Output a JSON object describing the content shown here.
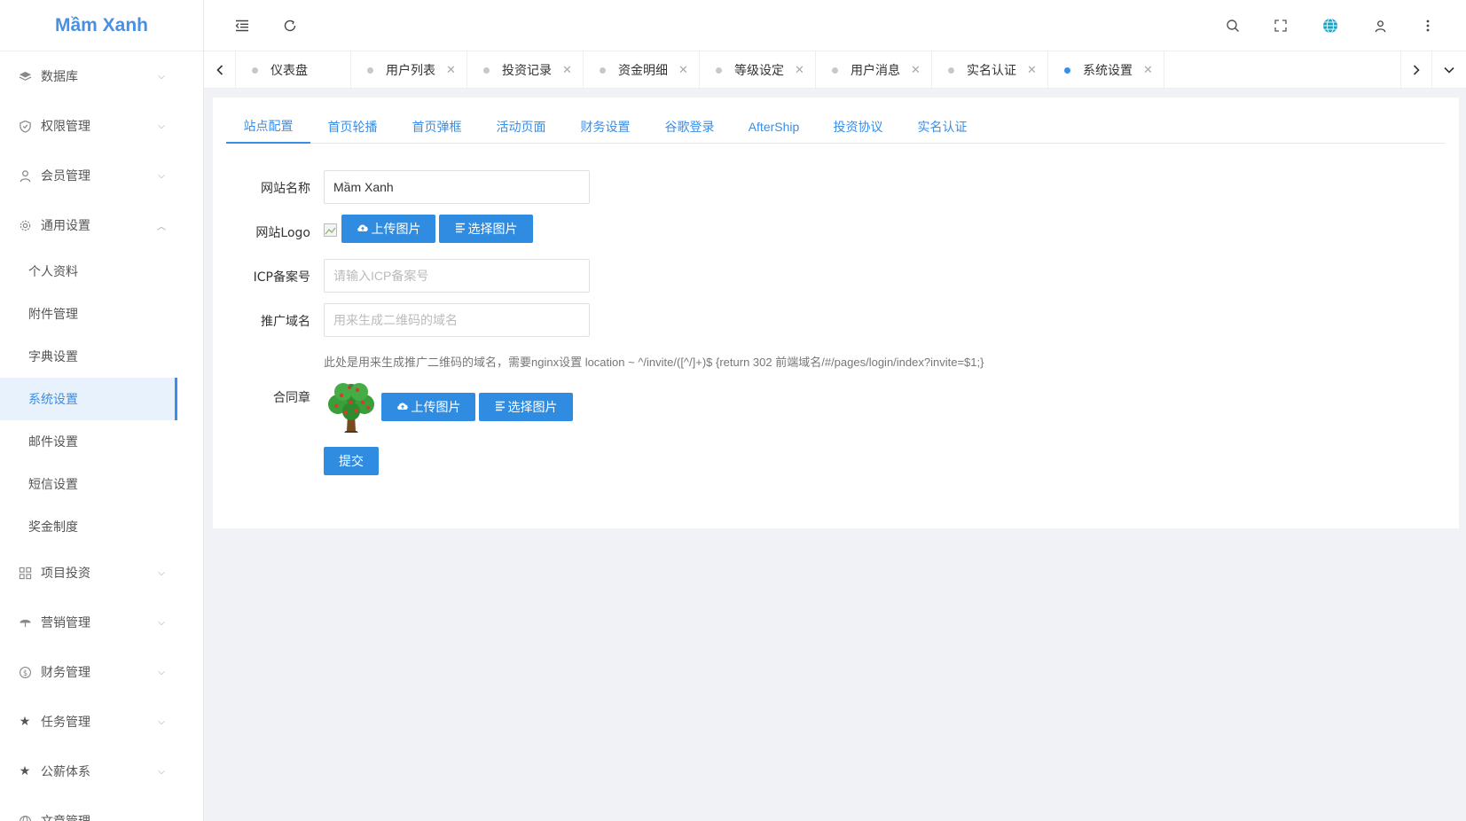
{
  "app": {
    "logo": "Mầm Xanh"
  },
  "sidebar": {
    "items": [
      {
        "label": "数据库",
        "icon": "layers-icon"
      },
      {
        "label": "权限管理",
        "icon": "shield-check-icon"
      },
      {
        "label": "会员管理",
        "icon": "user-icon"
      },
      {
        "label": "通用设置",
        "icon": "gear-icon",
        "expanded": true
      }
    ],
    "sub_items": [
      {
        "label": "个人资料"
      },
      {
        "label": "附件管理"
      },
      {
        "label": "字典设置"
      },
      {
        "label": "系统设置",
        "active": true
      },
      {
        "label": "邮件设置"
      },
      {
        "label": "短信设置"
      },
      {
        "label": "奖金制度"
      }
    ],
    "items_after": [
      {
        "label": "项目投资",
        "icon": "grid-icon"
      },
      {
        "label": "营销管理",
        "icon": "umbrella-icon"
      },
      {
        "label": "财务管理",
        "icon": "dollar-circle-icon"
      },
      {
        "label": "任务管理",
        "icon": "star-icon"
      },
      {
        "label": "公薪体系",
        "icon": "star-icon"
      },
      {
        "label": "文章管理",
        "icon": "globe-icon"
      }
    ]
  },
  "tabs": [
    {
      "label": "仪表盘",
      "closable": false
    },
    {
      "label": "用户列表",
      "closable": true
    },
    {
      "label": "投资记录",
      "closable": true
    },
    {
      "label": "资金明细",
      "closable": true
    },
    {
      "label": "等级设定",
      "closable": true
    },
    {
      "label": "用户消息",
      "closable": true
    },
    {
      "label": "实名认证",
      "closable": true
    },
    {
      "label": "系统设置",
      "closable": true,
      "active": true
    }
  ],
  "settings_tabs": [
    {
      "label": "站点配置",
      "active": true
    },
    {
      "label": "首页轮播"
    },
    {
      "label": "首页弹框"
    },
    {
      "label": "活动页面"
    },
    {
      "label": "财务设置"
    },
    {
      "label": "谷歌登录"
    },
    {
      "label": "AfterShip"
    },
    {
      "label": "投资协议"
    },
    {
      "label": "实名认证"
    }
  ],
  "form": {
    "site_name_label": "网站名称",
    "site_name_value": "Mầm Xanh",
    "site_logo_label": "网站Logo",
    "upload_label": "上传图片",
    "choose_label": "选择图片",
    "icp_label": "ICP备案号",
    "icp_placeholder": "请输入ICP备案号",
    "promo_domain_label": "推广域名",
    "promo_domain_placeholder": "用来生成二维码的域名",
    "promo_help": "此处是用来生成推广二维码的域名，需要nginx设置 location ~ ^/invite/([^/]+)$ {return 302 前端域名/#/pages/login/index?invite=$1;}",
    "seal_label": "合同章",
    "submit_label": "提交"
  },
  "colors": {
    "accent": "#3a8ee6",
    "button": "#2f8ce0",
    "logo": "#4a90e2"
  }
}
